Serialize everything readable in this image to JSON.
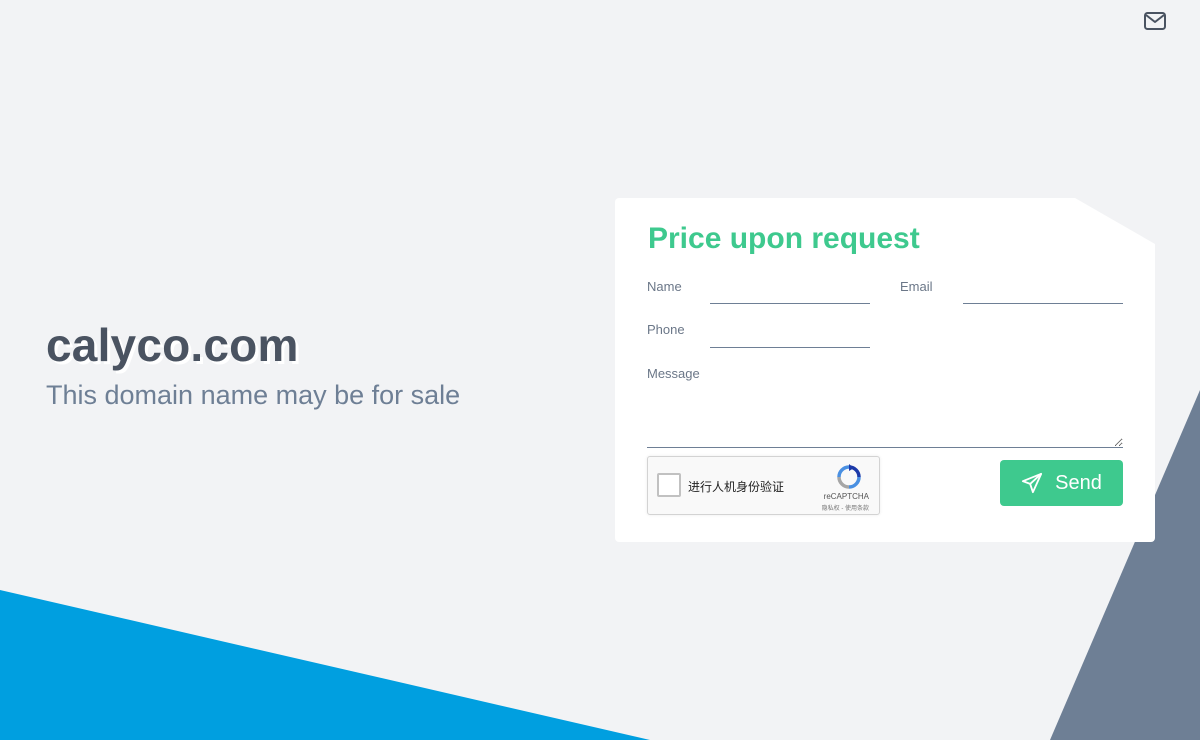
{
  "header": {
    "contact_icon": "envelope-icon"
  },
  "hero": {
    "domain": "calyco.com",
    "tagline": "This domain name may be for sale"
  },
  "form": {
    "title": "Price upon request",
    "name_label": "Name",
    "email_label": "Email",
    "phone_label": "Phone",
    "message_label": "Message",
    "name_value": "",
    "email_value": "",
    "phone_value": "",
    "message_value": "",
    "send_label": "Send",
    "send_icon": "paper-plane-icon"
  },
  "captcha": {
    "label": "进行人机身份验证",
    "brand": "reCAPTCHA",
    "links": "隐私权 - 使用条款",
    "icon": "recaptcha-logo-icon"
  },
  "colors": {
    "accent": "#3ec98e",
    "text_dark": "#4a5361",
    "text_muted": "#6e7f95",
    "blue_shape": "#009fe0",
    "slate_shape": "#6e7f95",
    "background": "#f2f3f5"
  }
}
